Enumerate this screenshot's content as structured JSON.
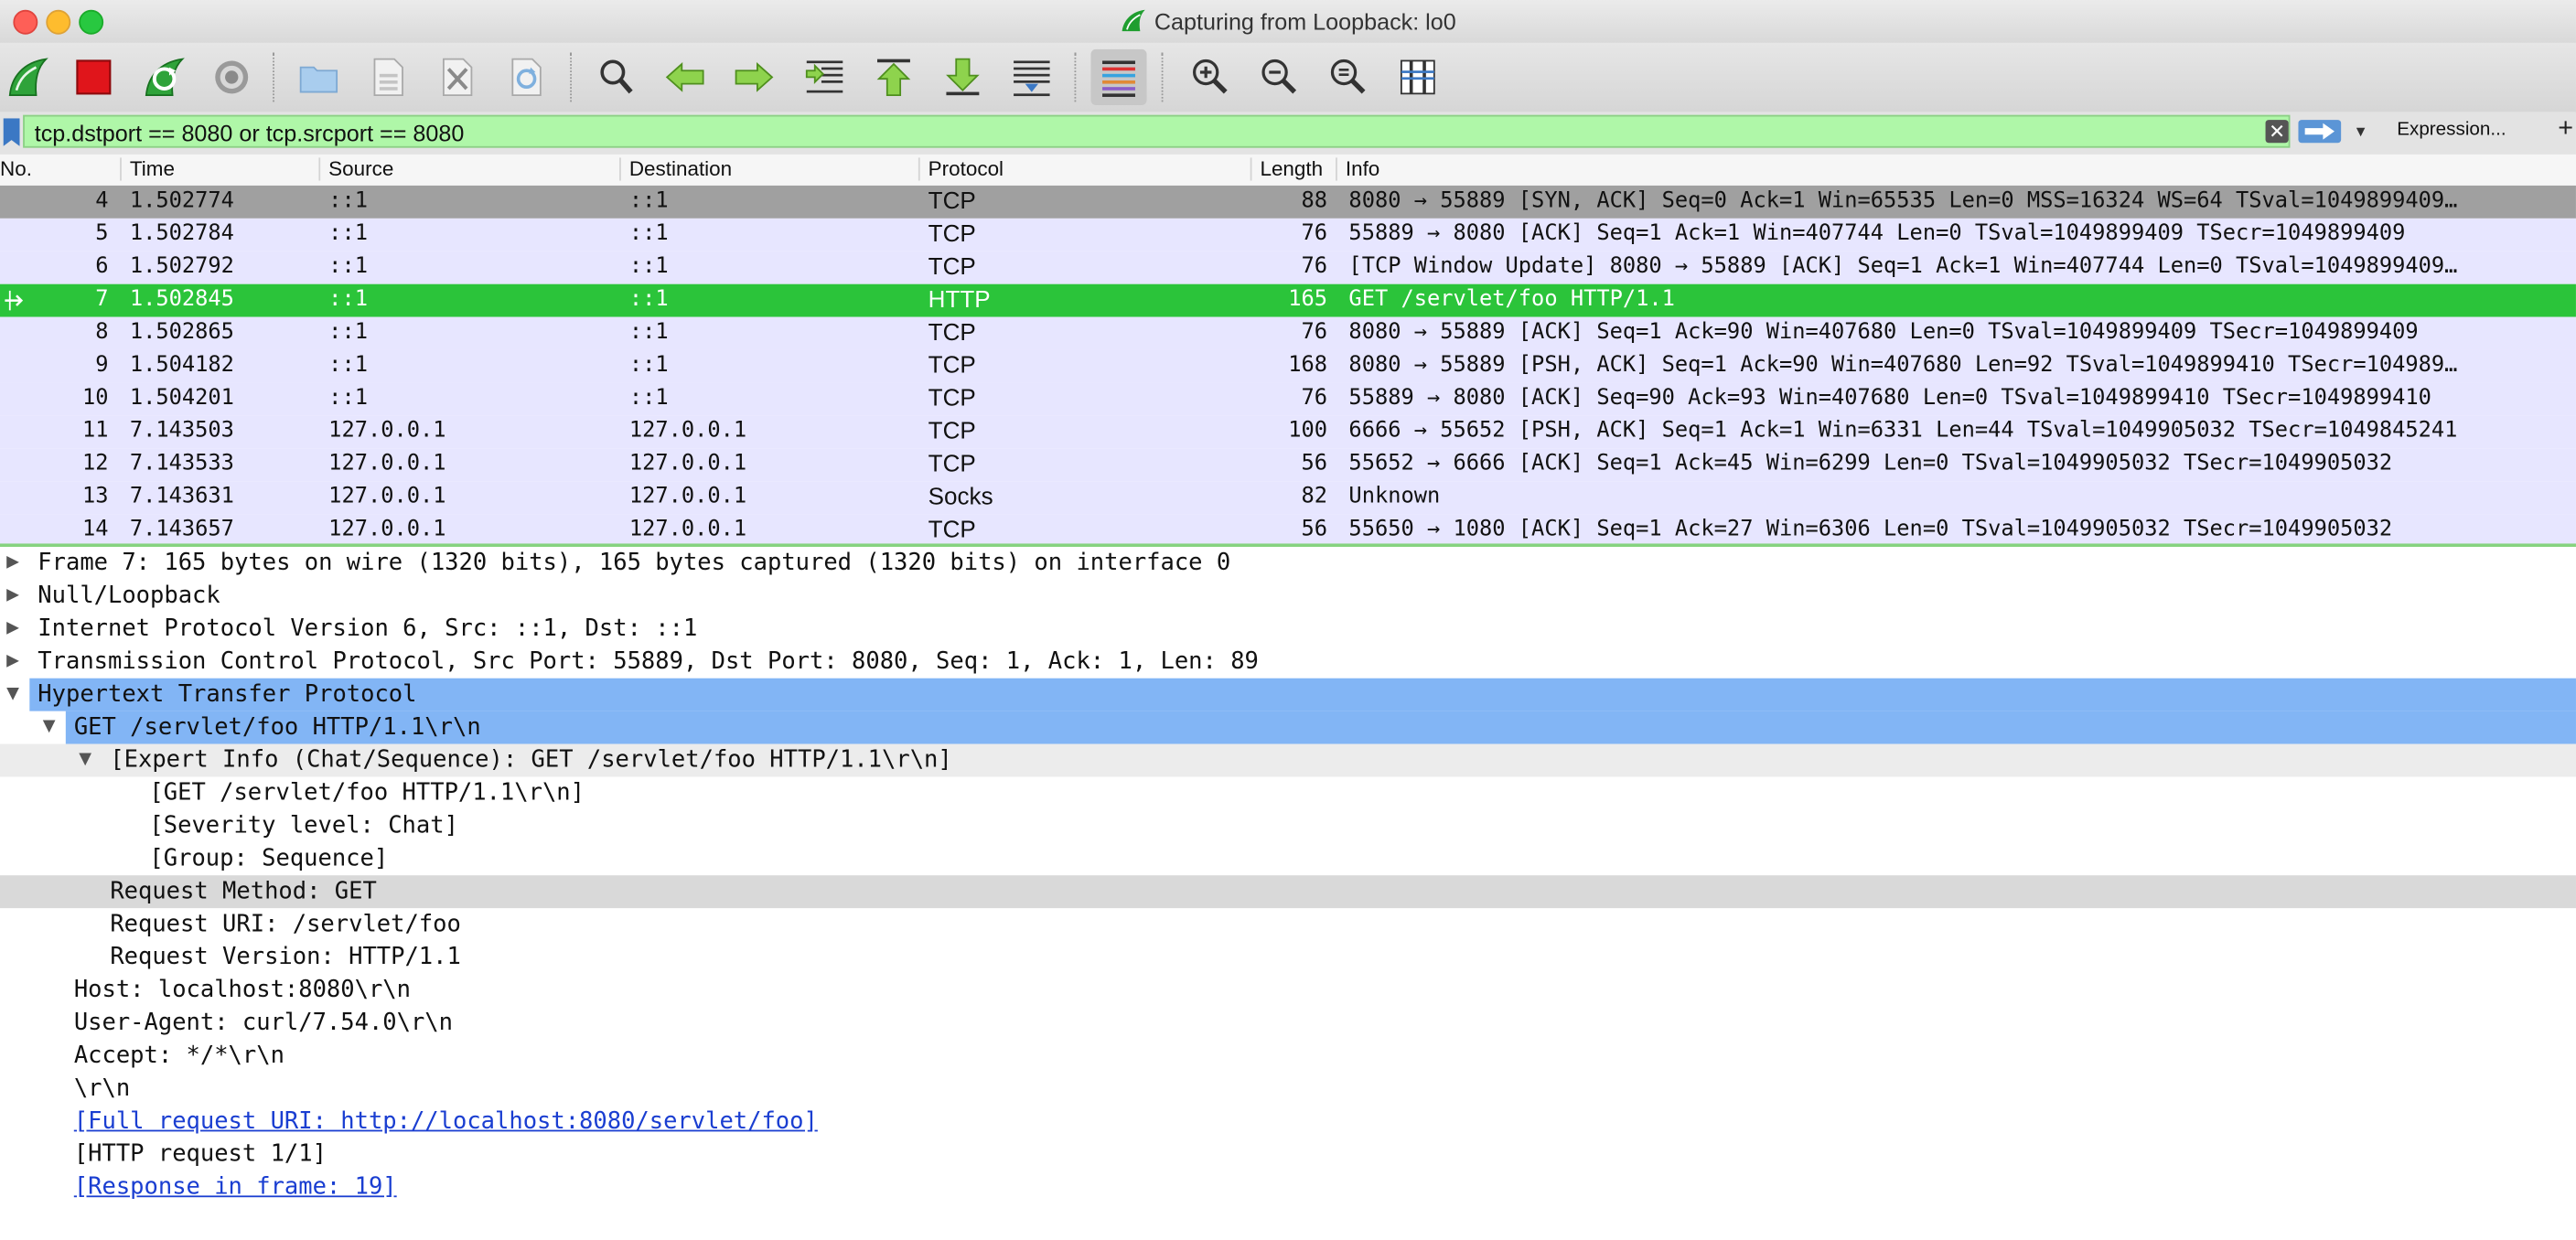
{
  "window": {
    "title": "Capturing from Loopback: lo0"
  },
  "toolbar": {
    "buttons": [
      {
        "name": "start-capture-icon"
      },
      {
        "name": "stop-capture-icon"
      },
      {
        "name": "restart-capture-icon"
      },
      {
        "name": "capture-options-icon"
      },
      {
        "name": "open-file-icon"
      },
      {
        "name": "save-file-icon"
      },
      {
        "name": "close-file-icon"
      },
      {
        "name": "reload-file-icon"
      },
      {
        "name": "find-packet-icon"
      },
      {
        "name": "go-back-icon"
      },
      {
        "name": "go-forward-icon"
      },
      {
        "name": "go-to-packet-icon"
      },
      {
        "name": "go-first-packet-icon"
      },
      {
        "name": "go-last-packet-icon"
      },
      {
        "name": "autoscroll-icon"
      },
      {
        "name": "colorize-icon"
      },
      {
        "name": "zoom-in-icon"
      },
      {
        "name": "zoom-out-icon"
      },
      {
        "name": "zoom-normal-icon"
      },
      {
        "name": "resize-columns-icon"
      }
    ]
  },
  "filter": {
    "value": "tcp.dstport == 8080 or tcp.srcport == 8080",
    "clear_label": "✕",
    "dropdown_label": "▼",
    "expression_label": "Expression...",
    "add_label": "+"
  },
  "packet_list": {
    "columns": [
      "No.",
      "Time",
      "Source",
      "Destination",
      "Protocol",
      "Length",
      "Info"
    ],
    "rows": [
      {
        "no": "4",
        "time": "1.502774",
        "src": "::1",
        "dst": "::1",
        "proto": "TCP",
        "len": "88",
        "info": "8080 → 55889 [SYN, ACK] Seq=0 Ack=1 Win=65535 Len=0 MSS=16324 WS=64 TSval=1049899409…"
      },
      {
        "no": "5",
        "time": "1.502784",
        "src": "::1",
        "dst": "::1",
        "proto": "TCP",
        "len": "76",
        "info": "55889 → 8080 [ACK] Seq=1 Ack=1 Win=407744 Len=0 TSval=1049899409 TSecr=1049899409"
      },
      {
        "no": "6",
        "time": "1.502792",
        "src": "::1",
        "dst": "::1",
        "proto": "TCP",
        "len": "76",
        "info": "[TCP Window Update] 8080 → 55889 [ACK] Seq=1 Ack=1 Win=407744 Len=0 TSval=1049899409…"
      },
      {
        "no": "7",
        "time": "1.502845",
        "src": "::1",
        "dst": "::1",
        "proto": "HTTP",
        "len": "165",
        "info": "GET /servlet/foo HTTP/1.1"
      },
      {
        "no": "8",
        "time": "1.502865",
        "src": "::1",
        "dst": "::1",
        "proto": "TCP",
        "len": "76",
        "info": "8080 → 55889 [ACK] Seq=1 Ack=90 Win=407680 Len=0 TSval=1049899409 TSecr=1049899409"
      },
      {
        "no": "9",
        "time": "1.504182",
        "src": "::1",
        "dst": "::1",
        "proto": "TCP",
        "len": "168",
        "info": "8080 → 55889 [PSH, ACK] Seq=1 Ack=90 Win=407680 Len=92 TSval=1049899410 TSecr=104989…"
      },
      {
        "no": "10",
        "time": "1.504201",
        "src": "::1",
        "dst": "::1",
        "proto": "TCP",
        "len": "76",
        "info": "55889 → 8080 [ACK] Seq=90 Ack=93 Win=407680 Len=0 TSval=1049899410 TSecr=1049899410"
      },
      {
        "no": "11",
        "time": "7.143503",
        "src": "127.0.0.1",
        "dst": "127.0.0.1",
        "proto": "TCP",
        "len": "100",
        "info": "6666 → 55652 [PSH, ACK] Seq=1 Ack=1 Win=6331 Len=44 TSval=1049905032 TSecr=1049845241"
      },
      {
        "no": "12",
        "time": "7.143533",
        "src": "127.0.0.1",
        "dst": "127.0.0.1",
        "proto": "TCP",
        "len": "56",
        "info": "55652 → 6666 [ACK] Seq=1 Ack=45 Win=6299 Len=0 TSval=1049905032 TSecr=1049905032"
      },
      {
        "no": "13",
        "time": "7.143631",
        "src": "127.0.0.1",
        "dst": "127.0.0.1",
        "proto": "Socks",
        "len": "82",
        "info": "Unknown"
      },
      {
        "no": "14",
        "time": "7.143657",
        "src": "127.0.0.1",
        "dst": "127.0.0.1",
        "proto": "TCP",
        "len": "56",
        "info": "55650 → 1080 [ACK] Seq=1 Ack=27 Win=6306 Len=0 TSval=1049905032 TSecr=1049905032"
      }
    ]
  },
  "details": {
    "rows": [
      {
        "text": "Frame 7: 165 bytes on wire (1320 bits), 165 bytes captured (1320 bits) on interface 0"
      },
      {
        "text": "Null/Loopback"
      },
      {
        "text": "Internet Protocol Version 6, Src: ::1, Dst: ::1"
      },
      {
        "text": "Transmission Control Protocol, Src Port: 55889, Dst Port: 8080, Seq: 1, Ack: 1, Len: 89"
      },
      {
        "text": "Hypertext Transfer Protocol"
      },
      {
        "text": "GET /servlet/foo HTTP/1.1\\r\\n"
      },
      {
        "text": "[Expert Info (Chat/Sequence): GET /servlet/foo HTTP/1.1\\r\\n]"
      },
      {
        "text": "[GET /servlet/foo HTTP/1.1\\r\\n]"
      },
      {
        "text": "[Severity level: Chat]"
      },
      {
        "text": "[Group: Sequence]"
      },
      {
        "text": "Request Method: GET"
      },
      {
        "text": "Request URI: /servlet/foo"
      },
      {
        "text": "Request Version: HTTP/1.1"
      },
      {
        "text": "Host: localhost:8080\\r\\n"
      },
      {
        "text": "User-Agent: curl/7.54.0\\r\\n"
      },
      {
        "text": "Accept: */*\\r\\n"
      },
      {
        "text": "\\r\\n"
      },
      {
        "text": "[Full request URI: http://localhost:8080/servlet/foo]"
      },
      {
        "text": "[HTTP request 1/1]"
      },
      {
        "text": "[Response in frame: 19]"
      }
    ]
  },
  "colors": {
    "filter_bg": "#aff7a8",
    "row_tcp": "#e7e6ff",
    "row_http": "#2bc43a",
    "row_selected": "#a0a0a0",
    "tree_selected": "#82b5f5"
  }
}
